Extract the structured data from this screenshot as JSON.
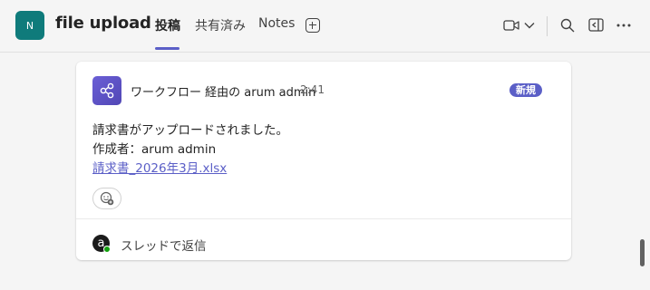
{
  "header": {
    "team_initial": "N",
    "title": "file upload",
    "tabs": [
      {
        "label": "投稿",
        "active": true
      },
      {
        "label": "共有済み",
        "active": false
      },
      {
        "label": "Notes",
        "active": false
      }
    ],
    "icons": [
      "add-tab-icon",
      "video-call-icon",
      "chevron-down-icon",
      "search-icon",
      "panel-icon",
      "more-icon"
    ]
  },
  "post": {
    "sender": "ワークフロー 経由の arum admin",
    "time": "2:41",
    "badge": "新規",
    "lines": [
      "請求書がアップロードされました。",
      "作成者：arum admin"
    ],
    "link": "請求書_2026年3月.xlsx",
    "reply_label": "スレッドで返信",
    "reply_avatar_letter": "a"
  },
  "colors": {
    "accent": "#5b5fc7",
    "team_avatar": "#0f7b7b",
    "presence": "#13a10e"
  }
}
